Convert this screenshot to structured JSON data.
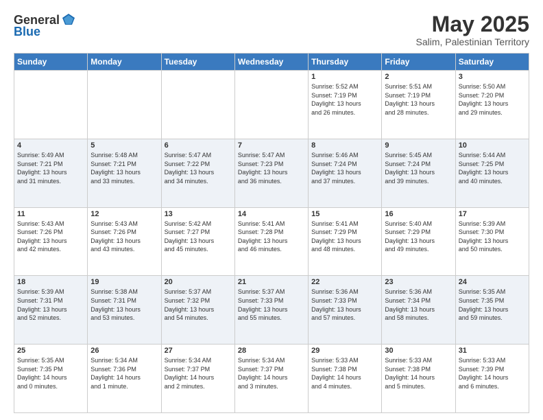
{
  "header": {
    "logo_line1": "General",
    "logo_line2": "Blue",
    "month": "May 2025",
    "location": "Salim, Palestinian Territory"
  },
  "weekdays": [
    "Sunday",
    "Monday",
    "Tuesday",
    "Wednesday",
    "Thursday",
    "Friday",
    "Saturday"
  ],
  "weeks": [
    [
      {
        "day": "",
        "info": ""
      },
      {
        "day": "",
        "info": ""
      },
      {
        "day": "",
        "info": ""
      },
      {
        "day": "",
        "info": ""
      },
      {
        "day": "1",
        "info": "Sunrise: 5:52 AM\nSunset: 7:19 PM\nDaylight: 13 hours\nand 26 minutes."
      },
      {
        "day": "2",
        "info": "Sunrise: 5:51 AM\nSunset: 7:19 PM\nDaylight: 13 hours\nand 28 minutes."
      },
      {
        "day": "3",
        "info": "Sunrise: 5:50 AM\nSunset: 7:20 PM\nDaylight: 13 hours\nand 29 minutes."
      }
    ],
    [
      {
        "day": "4",
        "info": "Sunrise: 5:49 AM\nSunset: 7:21 PM\nDaylight: 13 hours\nand 31 minutes."
      },
      {
        "day": "5",
        "info": "Sunrise: 5:48 AM\nSunset: 7:21 PM\nDaylight: 13 hours\nand 33 minutes."
      },
      {
        "day": "6",
        "info": "Sunrise: 5:47 AM\nSunset: 7:22 PM\nDaylight: 13 hours\nand 34 minutes."
      },
      {
        "day": "7",
        "info": "Sunrise: 5:47 AM\nSunset: 7:23 PM\nDaylight: 13 hours\nand 36 minutes."
      },
      {
        "day": "8",
        "info": "Sunrise: 5:46 AM\nSunset: 7:24 PM\nDaylight: 13 hours\nand 37 minutes."
      },
      {
        "day": "9",
        "info": "Sunrise: 5:45 AM\nSunset: 7:24 PM\nDaylight: 13 hours\nand 39 minutes."
      },
      {
        "day": "10",
        "info": "Sunrise: 5:44 AM\nSunset: 7:25 PM\nDaylight: 13 hours\nand 40 minutes."
      }
    ],
    [
      {
        "day": "11",
        "info": "Sunrise: 5:43 AM\nSunset: 7:26 PM\nDaylight: 13 hours\nand 42 minutes."
      },
      {
        "day": "12",
        "info": "Sunrise: 5:43 AM\nSunset: 7:26 PM\nDaylight: 13 hours\nand 43 minutes."
      },
      {
        "day": "13",
        "info": "Sunrise: 5:42 AM\nSunset: 7:27 PM\nDaylight: 13 hours\nand 45 minutes."
      },
      {
        "day": "14",
        "info": "Sunrise: 5:41 AM\nSunset: 7:28 PM\nDaylight: 13 hours\nand 46 minutes."
      },
      {
        "day": "15",
        "info": "Sunrise: 5:41 AM\nSunset: 7:29 PM\nDaylight: 13 hours\nand 48 minutes."
      },
      {
        "day": "16",
        "info": "Sunrise: 5:40 AM\nSunset: 7:29 PM\nDaylight: 13 hours\nand 49 minutes."
      },
      {
        "day": "17",
        "info": "Sunrise: 5:39 AM\nSunset: 7:30 PM\nDaylight: 13 hours\nand 50 minutes."
      }
    ],
    [
      {
        "day": "18",
        "info": "Sunrise: 5:39 AM\nSunset: 7:31 PM\nDaylight: 13 hours\nand 52 minutes."
      },
      {
        "day": "19",
        "info": "Sunrise: 5:38 AM\nSunset: 7:31 PM\nDaylight: 13 hours\nand 53 minutes."
      },
      {
        "day": "20",
        "info": "Sunrise: 5:37 AM\nSunset: 7:32 PM\nDaylight: 13 hours\nand 54 minutes."
      },
      {
        "day": "21",
        "info": "Sunrise: 5:37 AM\nSunset: 7:33 PM\nDaylight: 13 hours\nand 55 minutes."
      },
      {
        "day": "22",
        "info": "Sunrise: 5:36 AM\nSunset: 7:33 PM\nDaylight: 13 hours\nand 57 minutes."
      },
      {
        "day": "23",
        "info": "Sunrise: 5:36 AM\nSunset: 7:34 PM\nDaylight: 13 hours\nand 58 minutes."
      },
      {
        "day": "24",
        "info": "Sunrise: 5:35 AM\nSunset: 7:35 PM\nDaylight: 13 hours\nand 59 minutes."
      }
    ],
    [
      {
        "day": "25",
        "info": "Sunrise: 5:35 AM\nSunset: 7:35 PM\nDaylight: 14 hours\nand 0 minutes."
      },
      {
        "day": "26",
        "info": "Sunrise: 5:34 AM\nSunset: 7:36 PM\nDaylight: 14 hours\nand 1 minute."
      },
      {
        "day": "27",
        "info": "Sunrise: 5:34 AM\nSunset: 7:37 PM\nDaylight: 14 hours\nand 2 minutes."
      },
      {
        "day": "28",
        "info": "Sunrise: 5:34 AM\nSunset: 7:37 PM\nDaylight: 14 hours\nand 3 minutes."
      },
      {
        "day": "29",
        "info": "Sunrise: 5:33 AM\nSunset: 7:38 PM\nDaylight: 14 hours\nand 4 minutes."
      },
      {
        "day": "30",
        "info": "Sunrise: 5:33 AM\nSunset: 7:38 PM\nDaylight: 14 hours\nand 5 minutes."
      },
      {
        "day": "31",
        "info": "Sunrise: 5:33 AM\nSunset: 7:39 PM\nDaylight: 14 hours\nand 6 minutes."
      }
    ]
  ]
}
